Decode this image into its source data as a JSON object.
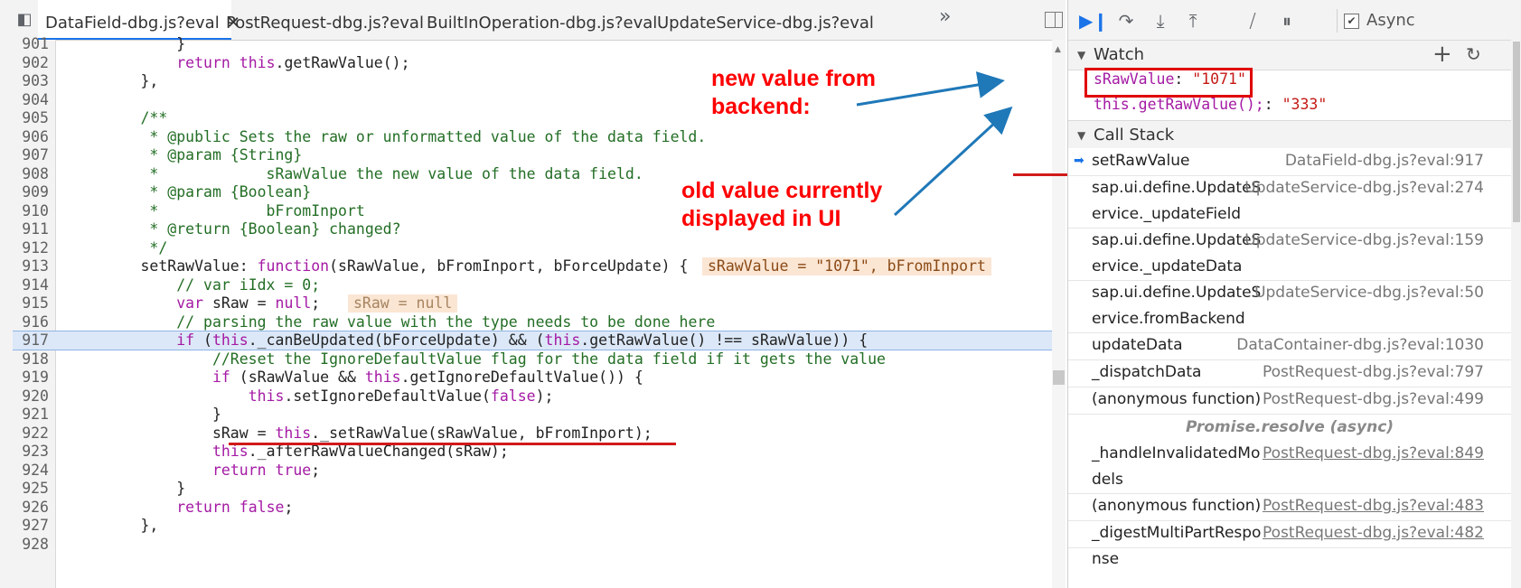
{
  "tabs": [
    {
      "label": "DataField-dbg.js?eval",
      "active": true,
      "closable": true
    },
    {
      "label": "PostRequest-dbg.js?eval"
    },
    {
      "label": "BuiltInOperation-dbg.js?eval"
    },
    {
      "label": "UpdateService-dbg.js?eval"
    }
  ],
  "tab_more_label": "»",
  "code_lines": [
    {
      "n": "901",
      "html": "            }"
    },
    {
      "n": "902",
      "html": "            <span class=\"kw\">return</span> <span class=\"kw\">this</span>.getRawValue();"
    },
    {
      "n": "903",
      "html": "        },"
    },
    {
      "n": "904",
      "html": ""
    },
    {
      "n": "905",
      "html": "        <span class=\"cm\">/**</span>"
    },
    {
      "n": "906",
      "html": "<span class=\"cm\">         * @public Sets the raw or unformatted value of the data field.</span>"
    },
    {
      "n": "907",
      "html": "<span class=\"cm\">         * @param {String}</span>"
    },
    {
      "n": "908",
      "html": "<span class=\"cm\">         *            sRawValue the new value of the data field.</span>"
    },
    {
      "n": "909",
      "html": "<span class=\"cm\">         * @param {Boolean}</span>"
    },
    {
      "n": "910",
      "html": "<span class=\"cm\">         *            bFromInport</span>"
    },
    {
      "n": "911",
      "html": "<span class=\"cm\">         * @return {Boolean} changed?</span>"
    },
    {
      "n": "912",
      "html": "<span class=\"cm\">         */</span>"
    },
    {
      "n": "913",
      "html": "        setRawValue: <span class=\"kw\">function</span>(sRawValue, bFromInport, bForceUpdate) {"
    },
    {
      "n": "914",
      "html": "            <span class=\"cm\">// var iIdx = 0;</span>"
    },
    {
      "n": "915",
      "html": "            <span class=\"kw\">var</span> sRaw = <span class=\"kw\">null</span>;"
    },
    {
      "n": "916",
      "html": "            <span class=\"cm\">// parsing the raw value with the type needs to be done here</span>"
    },
    {
      "n": "917",
      "html": "            <span class=\"kw\">if</span> (<span class=\"kw\">this</span>._canBeUpdated(bForceUpdate) &amp;&amp; (<span class=\"kw\">this</span>.getRawValue() !== sRawValue)) {",
      "highlight": true
    },
    {
      "n": "918",
      "html": "<span class=\"cm\">                //Reset the IgnoreDefaultValue flag for the data field if it gets the value</span>"
    },
    {
      "n": "919",
      "html": "                <span class=\"kw\">if</span> (sRawValue &amp;&amp; <span class=\"kw\">this</span>.getIgnoreDefaultValue()) {"
    },
    {
      "n": "920",
      "html": "                    <span class=\"kw\">this</span>.setIgnoreDefaultValue(<span class=\"kw\">false</span>);"
    },
    {
      "n": "921",
      "html": "                }"
    },
    {
      "n": "922",
      "html": "                sRaw = <span class=\"kw\">this</span>._setRawValue(sRawValue, bFromInport);"
    },
    {
      "n": "923",
      "html": "                <span class=\"kw\">this</span>._afterRawValueChanged(sRaw);"
    },
    {
      "n": "924",
      "html": "                <span class=\"kw\">return</span> <span class=\"kw\">true</span>;"
    },
    {
      "n": "925",
      "html": "            }"
    },
    {
      "n": "926",
      "html": "            <span class=\"kw\">return</span> <span class=\"kw\">false</span>;"
    },
    {
      "n": "927",
      "html": "        },"
    },
    {
      "n": "928",
      "html": ""
    }
  ],
  "inline_values": {
    "line913": "sRawValue = \"1071\", bFromInport",
    "line915": "sRaw = null"
  },
  "annotations": {
    "new_value": "new value from\nbackend:",
    "old_value": "old value currently\ndisplayed in UI"
  },
  "toolbar": {
    "async_label": "Async",
    "async_checked_mark": "✔"
  },
  "watch": {
    "title": "Watch",
    "add_label": "+",
    "refresh_label": "↻",
    "items": [
      {
        "name": "sRawValue",
        "sep": ": ",
        "value": "\"1071\""
      },
      {
        "name": "this.getRawValue();",
        "sep": ": ",
        "value": "\"333\""
      }
    ]
  },
  "callstack": {
    "title": "Call Stack",
    "frames": [
      {
        "fn": "setRawValue",
        "loc": "DataField-dbg.js?eval:917",
        "selected": true
      },
      {
        "fn": "sap.ui.define.UpdateService._updateField",
        "loc": "UpdateService-dbg.js?eval:274"
      },
      {
        "fn": "sap.ui.define.UpdateService._updateData",
        "loc": "UpdateService-dbg.js?eval:159"
      },
      {
        "fn": "sap.ui.define.UpdateService.fromBackend",
        "loc": "UpdateService-dbg.js?eval:50"
      },
      {
        "fn": "updateData",
        "loc": "DataContainer-dbg.js?eval:1030"
      },
      {
        "fn": "_dispatchData",
        "loc": "PostRequest-dbg.js?eval:797"
      },
      {
        "fn": "(anonymous function)",
        "loc": "PostRequest-dbg.js?eval:499"
      },
      {
        "fn": "_handleInvalidatedModels",
        "loc": "PostRequest-dbg.js?eval:849",
        "link": true
      },
      {
        "fn": "(anonymous function)",
        "loc": "PostRequest-dbg.js?eval:483",
        "link": true
      },
      {
        "fn": "_digestMultiPartResponse",
        "loc": "PostRequest-dbg.js?eval:482",
        "link": true
      }
    ],
    "async_separator": "Promise.resolve (async)"
  }
}
